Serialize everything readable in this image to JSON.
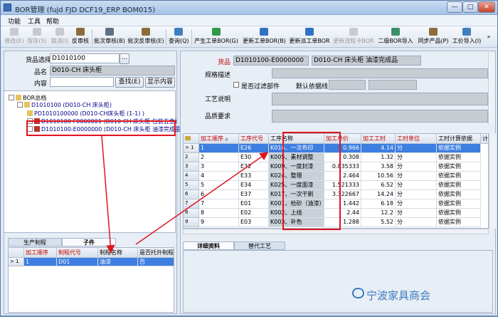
{
  "window": {
    "title": "BOR管理 (fujd FJD DCF19_ERP BOM015)",
    "min": "—",
    "max": "□",
    "close": "✕"
  },
  "menu": [
    "功能",
    "工具",
    "帮助"
  ],
  "toolbar": [
    {
      "label": "修改(E)",
      "disabled": true
    },
    {
      "label": "保存(S)",
      "disabled": true
    },
    {
      "label": "取消(I)",
      "disabled": true
    },
    {
      "label": "反审核",
      "disabled": false
    },
    {
      "label": "批次审核(B)",
      "disabled": false
    },
    {
      "label": "批次反审核(E)",
      "disabled": false
    },
    {
      "label": "查询(Q)",
      "disabled": false
    },
    {
      "label": "产生工单BOR(G)",
      "disabled": false
    },
    {
      "label": "更新工单BOR(B)",
      "disabled": false
    },
    {
      "label": "更新派工单BOR",
      "disabled": false
    },
    {
      "label": "更新流程卡BOR",
      "disabled": true
    },
    {
      "label": "二级BOR导入",
      "disabled": false
    },
    {
      "label": "同步产品(P)",
      "disabled": false
    },
    {
      "label": "工价导入(I)",
      "disabled": false
    }
  ],
  "left": {
    "product_select_label": "货品选择",
    "product_select_value": "D1010100",
    "product_select_btn": "...",
    "name_label": "品名",
    "name_value": "D010-CH 床头柜",
    "content_label": "内容",
    "content_value": "",
    "search_btn": "查找(E)",
    "show_btn": "显示内容",
    "tree": {
      "root": "BOR总档",
      "node1": "D1010100 (D010-CH 床头柜)",
      "node2": "PD1010100000 (D010-CH床头柜 (1-1) )",
      "node3": "D1010100-F0000001 (D010-CH 床头柜 包装五金)",
      "node4": "D1010100-E0000000 (D010-CH 床头柜 油漆完成品)"
    },
    "tabs": [
      "生产制程",
      "子件"
    ],
    "grid": {
      "headers": [
        "加工顺序",
        "制程代号",
        "制程名称",
        "是否托外制程"
      ],
      "rows": [
        {
          "rownum": "> 1",
          "seq": "1",
          "code": "D01",
          "name": "油漆",
          "outsource": "否"
        }
      ]
    }
  },
  "right": {
    "product_label": "货品",
    "product_code": "D1010100-E0000000",
    "product_name": "D010-CH 床头柜 油漆完成品",
    "spec_label": "规格描述",
    "spec_value": "",
    "pass_checkbox_label": "是否过滤部件",
    "default_line_label": "默认依据线",
    "process_desc_label": "工艺说明",
    "quality_label": "品质要求",
    "grid": {
      "headers": [
        "加工顺序",
        "工序代号",
        "工序名称",
        "加工单价",
        "加工工时",
        "工时单位",
        "工时计算依据",
        "计"
      ],
      "rows": [
        {
          "rownum": "> 1",
          "seq": "1",
          "code": "E26",
          "name": "K016、一次布印",
          "price": "0.966",
          "hours": "4.14",
          "unit": "分",
          "basis": "依据实例"
        },
        {
          "rownum": "2",
          "seq": "2",
          "code": "E30",
          "name": "K005、素材调整",
          "price": "0.308",
          "hours": "1.32",
          "unit": "分",
          "basis": "依据实例"
        },
        {
          "rownum": "3",
          "seq": "3",
          "code": "E32",
          "name": "K009、一度封漆",
          "price": "0.835333",
          "hours": "3.58",
          "unit": "分",
          "basis": "依据实例"
        },
        {
          "rownum": "4",
          "seq": "4",
          "code": "E33",
          "name": "K024、整理",
          "price": "2.464",
          "hours": "10.56",
          "unit": "分",
          "basis": "依据实例"
        },
        {
          "rownum": "5",
          "seq": "5",
          "code": "E34",
          "name": "K025、一度面漆",
          "price": "1.521333",
          "hours": "6.52",
          "unit": "分",
          "basis": "依据实例"
        },
        {
          "rownum": "6",
          "seq": "6",
          "code": "E37",
          "name": "K017、一次干刷",
          "price": "3.322667",
          "hours": "14.24",
          "unit": "分",
          "basis": "依据实例"
        },
        {
          "rownum": "7",
          "seq": "7",
          "code": "E01",
          "name": "K001、检砂（油漆）",
          "price": "1.442",
          "hours": "6.18",
          "unit": "分",
          "basis": "依据实例"
        },
        {
          "rownum": "8",
          "seq": "8",
          "code": "E02",
          "name": "K002、上线",
          "price": "2.44",
          "hours": "12.2",
          "unit": "分",
          "basis": "依据实例"
        },
        {
          "rownum": "9",
          "seq": "9",
          "code": "E03",
          "name": "K003、补色",
          "price": "1.288",
          "hours": "5.52",
          "unit": "分",
          "basis": "依据实例"
        }
      ]
    },
    "tabs": [
      "详细资料",
      "替代工艺"
    ]
  },
  "watermark": "宁波家具商会",
  "colors": {
    "highlight_red": "#e0141e",
    "selection_blue": "#3d7ee0",
    "header_red": "#c00000",
    "watermark_blue": "#3a7bbd"
  }
}
